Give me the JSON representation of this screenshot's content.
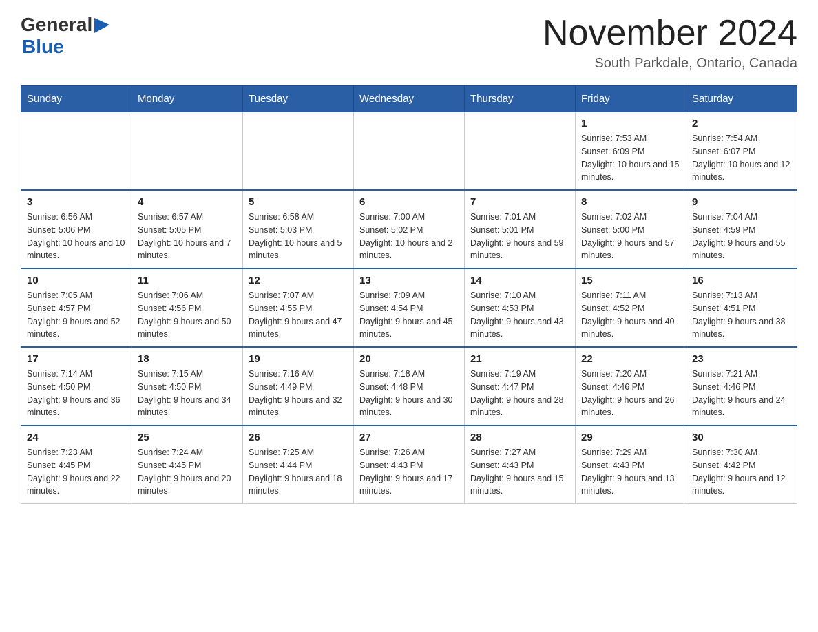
{
  "header": {
    "logo_general": "General",
    "logo_blue": "Blue",
    "month_title": "November 2024",
    "location": "South Parkdale, Ontario, Canada"
  },
  "days_of_week": [
    "Sunday",
    "Monday",
    "Tuesday",
    "Wednesday",
    "Thursday",
    "Friday",
    "Saturday"
  ],
  "weeks": [
    [
      {
        "day": "",
        "info": ""
      },
      {
        "day": "",
        "info": ""
      },
      {
        "day": "",
        "info": ""
      },
      {
        "day": "",
        "info": ""
      },
      {
        "day": "",
        "info": ""
      },
      {
        "day": "1",
        "info": "Sunrise: 7:53 AM\nSunset: 6:09 PM\nDaylight: 10 hours and 15 minutes."
      },
      {
        "day": "2",
        "info": "Sunrise: 7:54 AM\nSunset: 6:07 PM\nDaylight: 10 hours and 12 minutes."
      }
    ],
    [
      {
        "day": "3",
        "info": "Sunrise: 6:56 AM\nSunset: 5:06 PM\nDaylight: 10 hours and 10 minutes."
      },
      {
        "day": "4",
        "info": "Sunrise: 6:57 AM\nSunset: 5:05 PM\nDaylight: 10 hours and 7 minutes."
      },
      {
        "day": "5",
        "info": "Sunrise: 6:58 AM\nSunset: 5:03 PM\nDaylight: 10 hours and 5 minutes."
      },
      {
        "day": "6",
        "info": "Sunrise: 7:00 AM\nSunset: 5:02 PM\nDaylight: 10 hours and 2 minutes."
      },
      {
        "day": "7",
        "info": "Sunrise: 7:01 AM\nSunset: 5:01 PM\nDaylight: 9 hours and 59 minutes."
      },
      {
        "day": "8",
        "info": "Sunrise: 7:02 AM\nSunset: 5:00 PM\nDaylight: 9 hours and 57 minutes."
      },
      {
        "day": "9",
        "info": "Sunrise: 7:04 AM\nSunset: 4:59 PM\nDaylight: 9 hours and 55 minutes."
      }
    ],
    [
      {
        "day": "10",
        "info": "Sunrise: 7:05 AM\nSunset: 4:57 PM\nDaylight: 9 hours and 52 minutes."
      },
      {
        "day": "11",
        "info": "Sunrise: 7:06 AM\nSunset: 4:56 PM\nDaylight: 9 hours and 50 minutes."
      },
      {
        "day": "12",
        "info": "Sunrise: 7:07 AM\nSunset: 4:55 PM\nDaylight: 9 hours and 47 minutes."
      },
      {
        "day": "13",
        "info": "Sunrise: 7:09 AM\nSunset: 4:54 PM\nDaylight: 9 hours and 45 minutes."
      },
      {
        "day": "14",
        "info": "Sunrise: 7:10 AM\nSunset: 4:53 PM\nDaylight: 9 hours and 43 minutes."
      },
      {
        "day": "15",
        "info": "Sunrise: 7:11 AM\nSunset: 4:52 PM\nDaylight: 9 hours and 40 minutes."
      },
      {
        "day": "16",
        "info": "Sunrise: 7:13 AM\nSunset: 4:51 PM\nDaylight: 9 hours and 38 minutes."
      }
    ],
    [
      {
        "day": "17",
        "info": "Sunrise: 7:14 AM\nSunset: 4:50 PM\nDaylight: 9 hours and 36 minutes."
      },
      {
        "day": "18",
        "info": "Sunrise: 7:15 AM\nSunset: 4:50 PM\nDaylight: 9 hours and 34 minutes."
      },
      {
        "day": "19",
        "info": "Sunrise: 7:16 AM\nSunset: 4:49 PM\nDaylight: 9 hours and 32 minutes."
      },
      {
        "day": "20",
        "info": "Sunrise: 7:18 AM\nSunset: 4:48 PM\nDaylight: 9 hours and 30 minutes."
      },
      {
        "day": "21",
        "info": "Sunrise: 7:19 AM\nSunset: 4:47 PM\nDaylight: 9 hours and 28 minutes."
      },
      {
        "day": "22",
        "info": "Sunrise: 7:20 AM\nSunset: 4:46 PM\nDaylight: 9 hours and 26 minutes."
      },
      {
        "day": "23",
        "info": "Sunrise: 7:21 AM\nSunset: 4:46 PM\nDaylight: 9 hours and 24 minutes."
      }
    ],
    [
      {
        "day": "24",
        "info": "Sunrise: 7:23 AM\nSunset: 4:45 PM\nDaylight: 9 hours and 22 minutes."
      },
      {
        "day": "25",
        "info": "Sunrise: 7:24 AM\nSunset: 4:45 PM\nDaylight: 9 hours and 20 minutes."
      },
      {
        "day": "26",
        "info": "Sunrise: 7:25 AM\nSunset: 4:44 PM\nDaylight: 9 hours and 18 minutes."
      },
      {
        "day": "27",
        "info": "Sunrise: 7:26 AM\nSunset: 4:43 PM\nDaylight: 9 hours and 17 minutes."
      },
      {
        "day": "28",
        "info": "Sunrise: 7:27 AM\nSunset: 4:43 PM\nDaylight: 9 hours and 15 minutes."
      },
      {
        "day": "29",
        "info": "Sunrise: 7:29 AM\nSunset: 4:43 PM\nDaylight: 9 hours and 13 minutes."
      },
      {
        "day": "30",
        "info": "Sunrise: 7:30 AM\nSunset: 4:42 PM\nDaylight: 9 hours and 12 minutes."
      }
    ]
  ]
}
